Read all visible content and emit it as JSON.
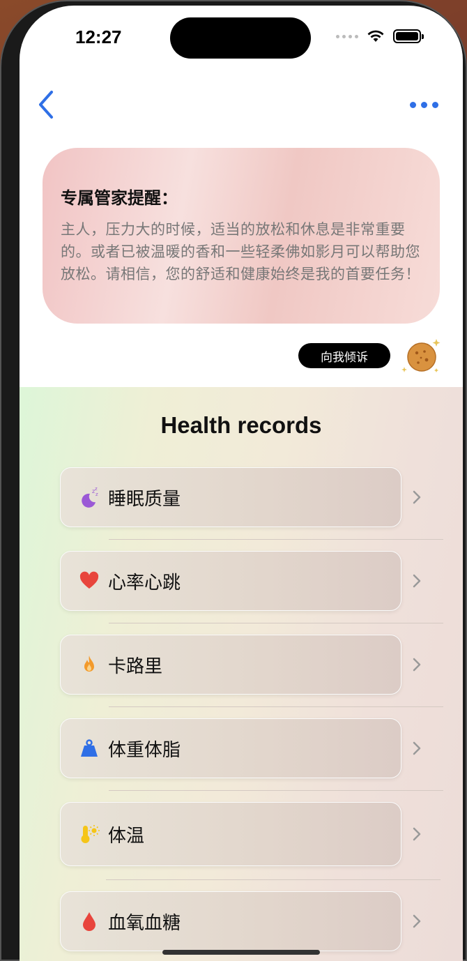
{
  "status_bar": {
    "time": "12:27"
  },
  "reminder": {
    "title": "专属管家提醒：",
    "body": "主人，压力大的时候，适当的放松和休息是非常重要的。或者已被温暖的香和一些轻柔佛如影月可以帮助您放松。请相信，您的舒适和健康始终是我的首要任务！"
  },
  "talk_button": {
    "label": "向我倾诉"
  },
  "health": {
    "title": "Health records",
    "items": [
      {
        "label": "睡眠质量",
        "icon": "moon-sleep-icon"
      },
      {
        "label": "心率心跳",
        "icon": "heart-icon"
      },
      {
        "label": "卡路里",
        "icon": "flame-icon"
      },
      {
        "label": "体重体脂",
        "icon": "weight-icon"
      },
      {
        "label": "体温",
        "icon": "thermometer-icon"
      },
      {
        "label": "血氧血糖",
        "icon": "blood-drop-icon"
      }
    ]
  },
  "colors": {
    "accent_blue": "#2f6fe6",
    "sleep_purple": "#9b59d6",
    "heart_red": "#e8453c",
    "flame_orange": "#f39a2b",
    "weight_blue": "#2f6fe6",
    "thermo_yellow": "#f5c518",
    "drop_red": "#e8453c"
  }
}
